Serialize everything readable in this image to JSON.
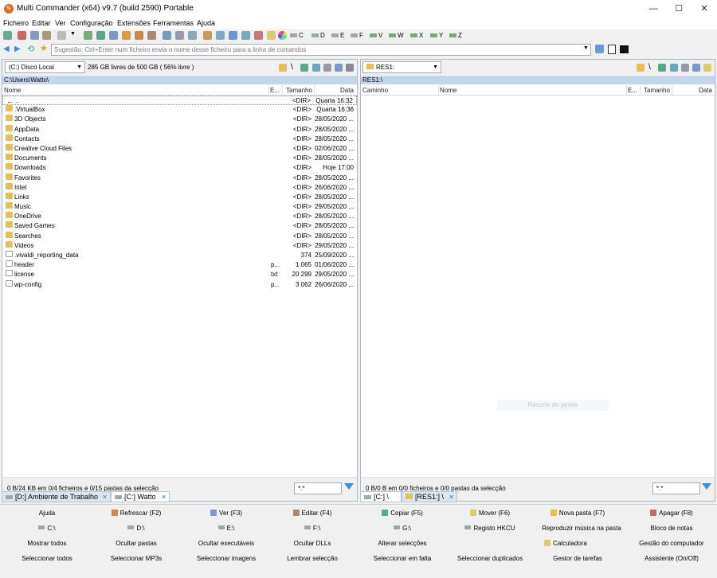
{
  "window": {
    "title": "Multi Commander (x64)  v9.7 (build 2590) Portable"
  },
  "menu": [
    "Ficheiro",
    "Editar",
    "Ver",
    "Configuração",
    "Extensões",
    "Ferramentas",
    "Ajuda"
  ],
  "drives": [
    "C",
    "D",
    "E",
    "F",
    "V",
    "W",
    "X",
    "Y",
    "Z"
  ],
  "cmd": {
    "placeholder": "Sugestão: Ctrl+Enter num ficheiro envia o nome desse ficheiro para a linha de comandos"
  },
  "left": {
    "drive": "(C:) Disco Local",
    "free": "285 GB livres de 500 GB ( 56% livre )",
    "path": "C:\\Users\\Watto\\",
    "cols": {
      "name": "Nome",
      "ext": "E...",
      "size": "Tamanho",
      "date": "Data"
    },
    "rows": [
      {
        "name": "..",
        "ext": "",
        "size": "<DIR>",
        "date": "Quarta 16:32",
        "type": "up"
      },
      {
        "name": ".VirtualBox",
        "ext": "",
        "size": "<DIR>",
        "date": "Quarta 16:36",
        "type": "dir"
      },
      {
        "name": "3D Objects",
        "ext": "",
        "size": "<DIR>",
        "date": "28/05/2020 ...",
        "type": "dir"
      },
      {
        "name": "AppData",
        "ext": "",
        "size": "<DIR>",
        "date": "28/05/2020 ...",
        "type": "dir"
      },
      {
        "name": "Contacts",
        "ext": "",
        "size": "<DIR>",
        "date": "28/05/2020 ...",
        "type": "dir"
      },
      {
        "name": "Creative Cloud Files",
        "ext": "",
        "size": "<DIR>",
        "date": "02/06/2020 ...",
        "type": "dir"
      },
      {
        "name": "Documents",
        "ext": "",
        "size": "<DIR>",
        "date": "28/05/2020 ...",
        "type": "dir"
      },
      {
        "name": "Downloads",
        "ext": "",
        "size": "<DIR>",
        "date": "Hoje 17:00",
        "type": "dir"
      },
      {
        "name": "Favorites",
        "ext": "",
        "size": "<DIR>",
        "date": "28/05/2020 ...",
        "type": "dir"
      },
      {
        "name": "Intel",
        "ext": "",
        "size": "<DIR>",
        "date": "26/06/2020 ...",
        "type": "dir"
      },
      {
        "name": "Links",
        "ext": "",
        "size": "<DIR>",
        "date": "28/05/2020 ...",
        "type": "dir"
      },
      {
        "name": "Music",
        "ext": "",
        "size": "<DIR>",
        "date": "29/05/2020 ...",
        "type": "dir"
      },
      {
        "name": "OneDrive",
        "ext": "",
        "size": "<DIR>",
        "date": "28/05/2020 ...",
        "type": "dir"
      },
      {
        "name": "Saved Games",
        "ext": "",
        "size": "<DIR>",
        "date": "28/05/2020 ...",
        "type": "dir"
      },
      {
        "name": "Searches",
        "ext": "",
        "size": "<DIR>",
        "date": "28/05/2020 ...",
        "type": "dir"
      },
      {
        "name": "Videos",
        "ext": "",
        "size": "<DIR>",
        "date": "29/05/2020 ...",
        "type": "dir"
      },
      {
        "name": ".vivaldi_reporting_data",
        "ext": "",
        "size": "374",
        "date": "25/09/2020 ...",
        "type": "file"
      },
      {
        "name": "header",
        "ext": "p...",
        "size": "1 065",
        "date": "01/06/2020 ...",
        "type": "file"
      },
      {
        "name": "license",
        "ext": "txt",
        "size": "20 299",
        "date": "29/05/2020 ...",
        "type": "file"
      },
      {
        "name": "wp-config",
        "ext": "p...",
        "size": "3 062",
        "date": "26/06/2020 ...",
        "type": "file"
      }
    ],
    "status": "0 B/24 KB em 0/4 ficheiros e 0/15 pastas da selecção",
    "filter": "*.*",
    "tabs": [
      "[D:] Ambiente de Trabalho",
      "[C:] Watto"
    ]
  },
  "right": {
    "drive": "RES1:",
    "path": "RES1:\\",
    "cols": {
      "path": "Caminho",
      "name": "Nome",
      "ext": "E...",
      "size": "Tamanho",
      "date": "Data"
    },
    "status": "0 B/0 B em 0/0 ficheiros e 0/0 pastas da selecção",
    "filter": "*.*",
    "tabs": [
      "[C:] \\",
      "[RES1:] \\"
    ],
    "hint": "Recorte de janela"
  },
  "fbuttons": [
    [
      "Ajuda",
      "Refrescar (F2)",
      "Ver (F3)",
      "Editar (F4)",
      "Copiar (F5)",
      "Mover (F6)",
      "Nova pasta (F7)",
      "Apagar (F8)"
    ],
    [
      "C:\\",
      "D:\\",
      "E:\\",
      "F:\\",
      "G:\\",
      "Registo HKCU",
      "Reproduzir música na pasta",
      "Bloco de notas"
    ],
    [
      "Mostrar todos",
      "Ocultar pastas",
      "Ocultar executáveis",
      "Ocultar DLLs",
      "Alterar selecções",
      "Calculadora",
      "Gestão do computador"
    ],
    [
      "Seleccionar todos",
      "Seleccionar MP3s",
      "Seleccionar imagens",
      "Lembrar selecção",
      "Seleccionar em falta",
      "Seleccionar duplicados",
      "Gestor de tarefas",
      "Assistente (On/Off)"
    ]
  ],
  "colors": {
    "path_bar": "#c5d6ea",
    "folder": "#e8c050",
    "accent": "#3a8fd8"
  }
}
